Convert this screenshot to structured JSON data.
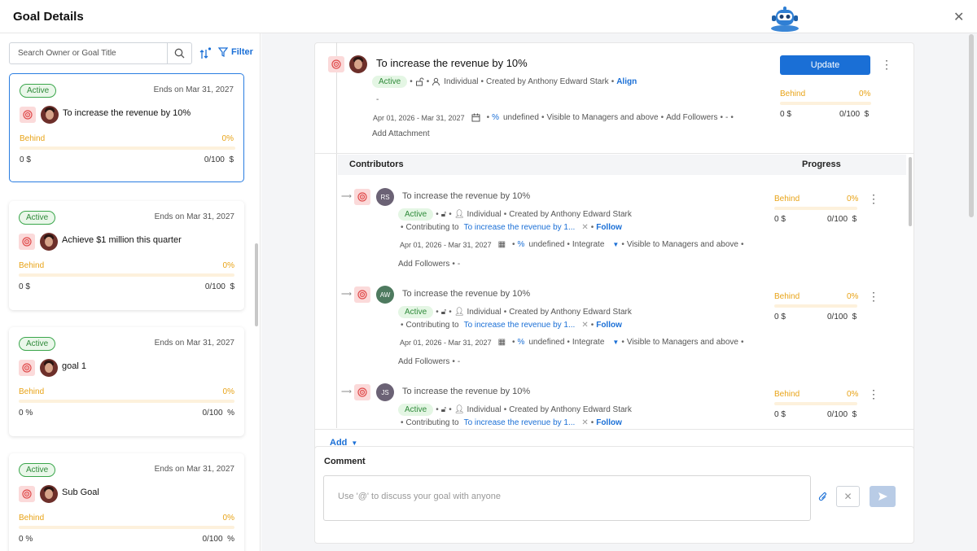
{
  "header": {
    "title": "Goal Details"
  },
  "search": {
    "placeholder": "Search Owner or Goal Title"
  },
  "toolbar": {
    "filter_label": "Filter"
  },
  "goal_cards": [
    {
      "status": "Active",
      "ends": "Ends on Mar 31, 2027",
      "title": "To increase the revenue by 10%",
      "progress_status": "Behind",
      "percent": "0%",
      "progress": 0,
      "current": "0 $",
      "target": "0/100",
      "unit": "$"
    },
    {
      "status": "Active",
      "ends": "Ends on Mar 31, 2027",
      "title": "Achieve $1 million this quarter",
      "progress_status": "Behind",
      "percent": "0%",
      "progress": 0,
      "current": "0 $",
      "target": "0/100",
      "unit": "$"
    },
    {
      "status": "Active",
      "ends": "Ends on Mar 31, 2027",
      "title": "goal 1",
      "progress_status": "Behind",
      "percent": "0%",
      "progress": 0,
      "current": "0 %",
      "target": "0/100",
      "unit": "%"
    },
    {
      "status": "Active",
      "ends": "Ends on Mar 31, 2027",
      "title": "Sub Goal",
      "progress_status": "Behind",
      "percent": "0%",
      "progress": 0,
      "current": "0 %",
      "target": "0/100",
      "unit": "%"
    }
  ],
  "goal": {
    "title": "To increase the revenue by 10%",
    "status": "Active",
    "type": "Individual",
    "created_by": "Created by Anthony Edward Stark",
    "align_label": "Align",
    "dash": "-",
    "dates": "Apr 01, 2026 - Mar 31, 2027",
    "measure": "undefined",
    "visibility": "Visible to Managers and above",
    "add_followers": "Add Followers",
    "dash2": "-",
    "add_attachment": "Add Attachment",
    "update_label": "Update",
    "progress_status": "Behind",
    "percent": "0%",
    "progress": 0,
    "current": "0 $",
    "target": "0/100",
    "unit": "$"
  },
  "contributors_header": {
    "contributors": "Contributors",
    "progress": "Progress"
  },
  "contributors": [
    {
      "initials": "RS",
      "color": "#6b6275",
      "title": "To increase the revenue by 10%",
      "status": "Active",
      "type": "Individual",
      "created_by": "Created by Anthony Edward Stark",
      "contributing_to": "Contributing to",
      "parent": "To increase the revenue by 1...",
      "follow": "Follow",
      "dates": "Apr 01, 2026 - Mar 31, 2027",
      "measure": "undefined",
      "integrate": "Integrate",
      "visibility": "Visible to Managers and above",
      "add_followers": "Add Followers",
      "dash": "-",
      "progress_status": "Behind",
      "percent": "0%",
      "progress": 0,
      "current": "0 $",
      "target": "0/100",
      "unit": "$"
    },
    {
      "initials": "AW",
      "color": "#4e7a5f",
      "title": "To increase the revenue by 10%",
      "status": "Active",
      "type": "Individual",
      "created_by": "Created by Anthony Edward Stark",
      "contributing_to": "Contributing to",
      "parent": "To increase the revenue by 1...",
      "follow": "Follow",
      "dates": "Apr 01, 2026 - Mar 31, 2027",
      "measure": "undefined",
      "integrate": "Integrate",
      "visibility": "Visible to Managers and above",
      "add_followers": "Add Followers",
      "dash": "-",
      "progress_status": "Behind",
      "percent": "0%",
      "progress": 0,
      "current": "0 $",
      "target": "0/100",
      "unit": "$"
    },
    {
      "initials": "JS",
      "color": "#6b6275",
      "title": "To increase the revenue by 10%",
      "status": "Active",
      "type": "Individual",
      "created_by": "Created by Anthony Edward Stark",
      "contributing_to": "Contributing to",
      "parent": "To increase the revenue by 1...",
      "follow": "Follow",
      "progress_status": "Behind",
      "percent": "0%",
      "progress": 0,
      "current": "0 $",
      "target": "0/100",
      "unit": "$"
    }
  ],
  "add": {
    "label": "Add"
  },
  "comment": {
    "heading": "Comment",
    "placeholder": "Use '@' to discuss your goal with anyone"
  },
  "colors": {
    "accent": "#1a6fd6",
    "behind": "#e8a317",
    "active_green": "#2f8a3a",
    "goal_icon_bg": "#fbdada"
  }
}
